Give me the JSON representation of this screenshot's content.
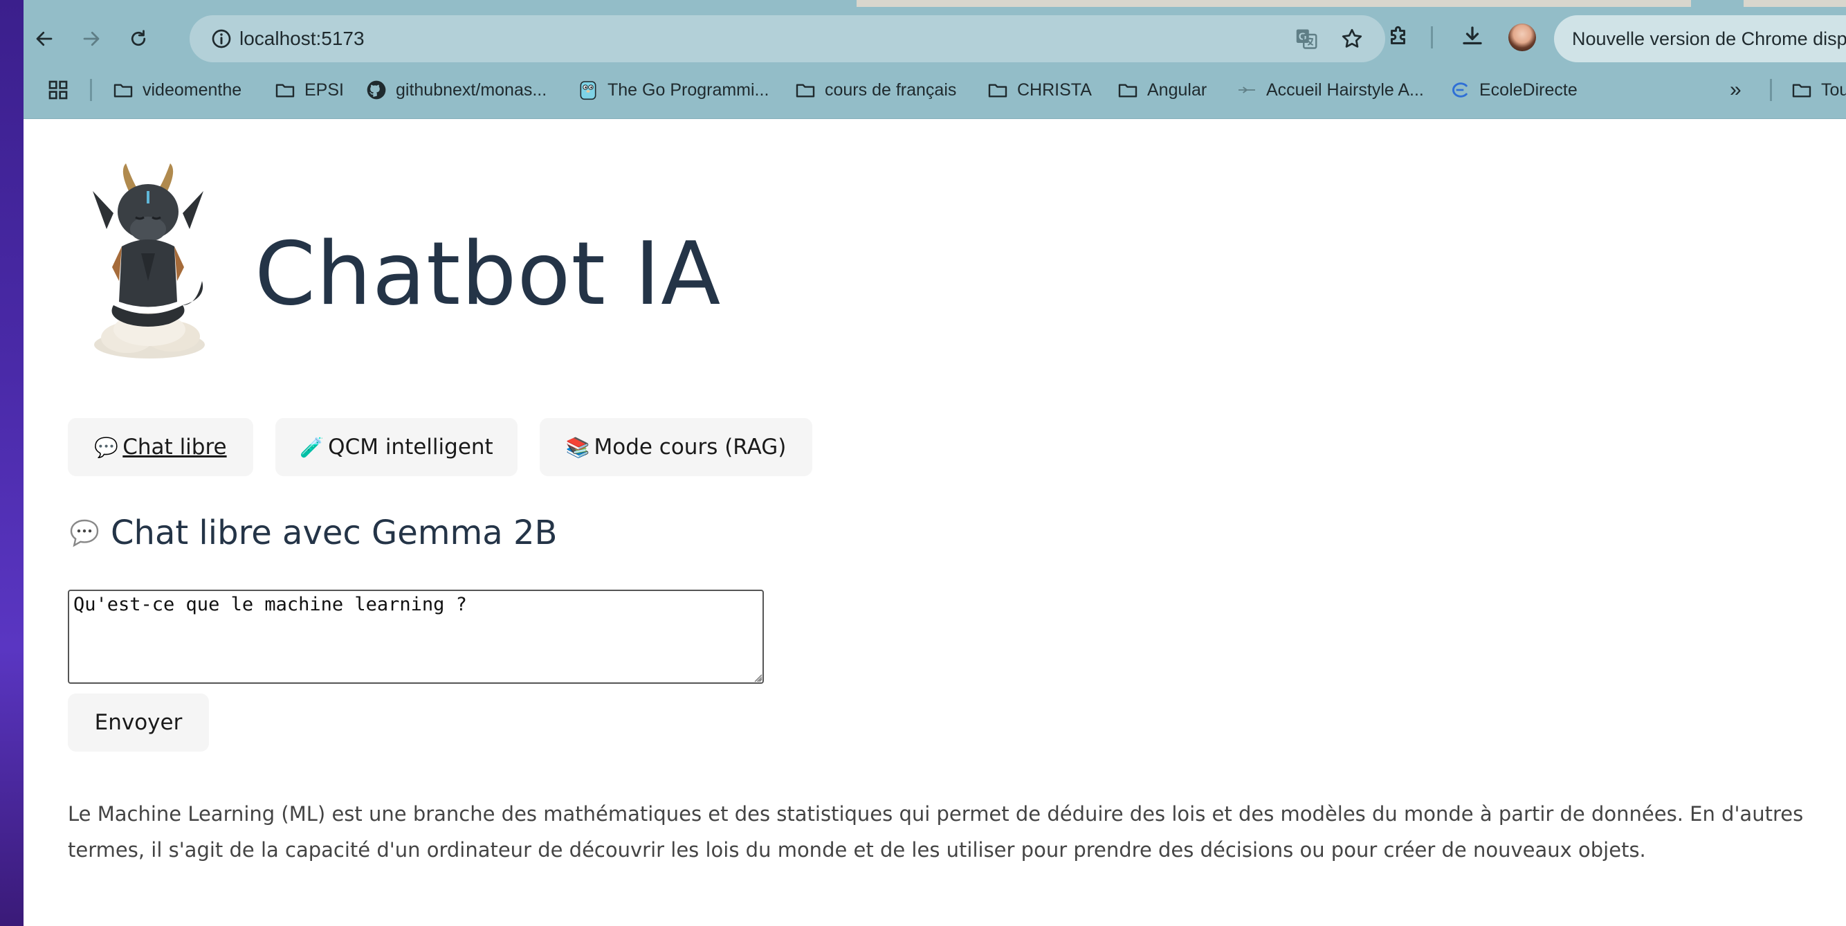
{
  "browser": {
    "url": "localhost:5173",
    "update_notice": "Nouvelle version de Chrome disp",
    "bookmarks": [
      {
        "label": "videomenthe",
        "icon": "folder-icon"
      },
      {
        "label": "EPSI",
        "icon": "folder-icon"
      },
      {
        "label": "githubnext/monas...",
        "icon": "github-icon"
      },
      {
        "label": "The Go Programmi...",
        "icon": "gopher-icon"
      },
      {
        "label": "cours de français",
        "icon": "folder-icon"
      },
      {
        "label": "CHRISTA",
        "icon": "folder-icon"
      },
      {
        "label": "Angular",
        "icon": "folder-icon"
      },
      {
        "label": "Accueil Hairstyle A...",
        "icon": "site-icon"
      },
      {
        "label": "EcoleDirecte",
        "icon": "ecoledirecte-icon"
      }
    ],
    "bookmarks_overflow": "»",
    "all_bookmarks": "Tous"
  },
  "app": {
    "title": "Chatbot IA",
    "tabs": [
      {
        "emoji": "💬",
        "label": "Chat libre",
        "active": true
      },
      {
        "emoji": "🧪",
        "label": "QCM intelligent",
        "active": false
      },
      {
        "emoji": "📚",
        "label": "Mode cours (RAG)",
        "active": false
      }
    ],
    "section_title": "Chat libre avec Gemma 2B",
    "prompt_value": "Qu'est-ce que le machine learning ?",
    "send_label": "Envoyer",
    "answer": "Le Machine Learning (ML) est une branche des mathématiques et des statistiques qui permet de déduire des lois et des modèles du monde à partir de données. En d'autres termes, il s'agit de la capacité d'un ordinateur de découvrir les lois du monde et de les utiliser pour prendre des décisions ou pour créer de nouveaux objets."
  },
  "colors": {
    "chrome_toolbar": "#93bdc8",
    "omnibox": "#b3d0d8",
    "title_text": "#243447",
    "tab_background": "#f5f5f5",
    "answer_text": "#444444"
  }
}
